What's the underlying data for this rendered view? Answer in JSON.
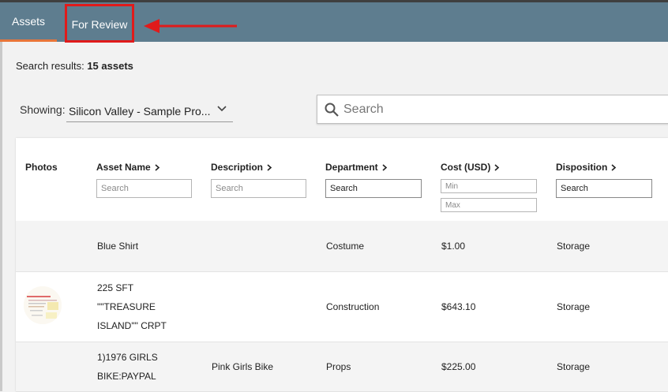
{
  "tabs": [
    {
      "label": "Assets"
    },
    {
      "label": "For Review"
    }
  ],
  "results": {
    "prefix": "Search results:",
    "count": "15 assets"
  },
  "filter": {
    "label": "Showing:",
    "value": "Silicon Valley - Sample Pro..."
  },
  "search": {
    "placeholder": "Search"
  },
  "columns": {
    "photos": "Photos",
    "asset_name": "Asset Name",
    "description": "Description",
    "department": "Department",
    "cost": "Cost (USD)",
    "disposition": "Disposition"
  },
  "filters": {
    "asset_name_placeholder": "Search",
    "description_placeholder": "Search",
    "department_placeholder": "Search",
    "cost_min_placeholder": "Min",
    "cost_max_placeholder": "Max",
    "disposition_placeholder": "Search"
  },
  "rows": [
    {
      "name_lines": [
        "Blue Shirt"
      ],
      "description": "",
      "department": "Costume",
      "cost": "$1.00",
      "disposition": "Storage"
    },
    {
      "name_lines": [
        "225 SFT",
        "\"\"TREASURE",
        "ISLAND\"\" CRPT"
      ],
      "description": "",
      "department": "Construction",
      "cost": "$643.10",
      "disposition": "Storage"
    },
    {
      "name_lines": [
        "1)1976 GIRLS",
        "BIKE:PAYPAL"
      ],
      "description": "Pink Girls Bike",
      "department": "Props",
      "cost": "$225.00",
      "disposition": "Storage"
    }
  ],
  "colors": {
    "topbar": "#5e7d8f",
    "active_tab_underline": "#e8763a",
    "highlight": "#e01b1b"
  },
  "icons": {
    "arrow": "left-arrow-icon",
    "search": "search-icon",
    "chevron": "chevron-down-icon",
    "sort": "chevron-right-icon"
  }
}
